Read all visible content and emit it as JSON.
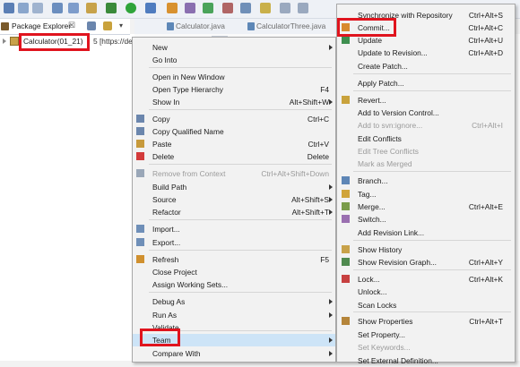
{
  "package_explorer": {
    "tab_label": "Package Explorer",
    "tab_close": "☒",
    "project_label": "Calculator(01_21)",
    "project_suffix": "5 [https://de"
  },
  "editor": {
    "tabs": [
      "Calculator.java",
      "CalculatorThree.java"
    ]
  },
  "context_menu": {
    "items": [
      {
        "label": "New",
        "shortcut": "",
        "submenu": true,
        "enabled": true
      },
      {
        "label": "Go Into",
        "shortcut": "",
        "submenu": false,
        "enabled": true
      },
      {
        "label": "Open in New Window",
        "shortcut": "",
        "submenu": false,
        "enabled": true
      },
      {
        "label": "Open Type Hierarchy",
        "shortcut": "F4",
        "submenu": false,
        "enabled": true
      },
      {
        "label": "Show In",
        "shortcut": "Alt+Shift+W",
        "submenu": true,
        "enabled": true
      },
      {
        "label": "Copy",
        "shortcut": "Ctrl+C",
        "submenu": false,
        "enabled": true
      },
      {
        "label": "Copy Qualified Name",
        "shortcut": "",
        "submenu": false,
        "enabled": true
      },
      {
        "label": "Paste",
        "shortcut": "Ctrl+V",
        "submenu": false,
        "enabled": true
      },
      {
        "label": "Delete",
        "shortcut": "Delete",
        "submenu": false,
        "enabled": true
      },
      {
        "label": "Remove from Context",
        "shortcut": "Ctrl+Alt+Shift+Down",
        "submenu": false,
        "enabled": false
      },
      {
        "label": "Build Path",
        "shortcut": "",
        "submenu": true,
        "enabled": true
      },
      {
        "label": "Source",
        "shortcut": "Alt+Shift+S",
        "submenu": true,
        "enabled": true
      },
      {
        "label": "Refactor",
        "shortcut": "Alt+Shift+T",
        "submenu": true,
        "enabled": true
      },
      {
        "label": "Import...",
        "shortcut": "",
        "submenu": false,
        "enabled": true
      },
      {
        "label": "Export...",
        "shortcut": "",
        "submenu": false,
        "enabled": true
      },
      {
        "label": "Refresh",
        "shortcut": "F5",
        "submenu": false,
        "enabled": true
      },
      {
        "label": "Close Project",
        "shortcut": "",
        "submenu": false,
        "enabled": true
      },
      {
        "label": "Assign Working Sets...",
        "shortcut": "",
        "submenu": false,
        "enabled": true
      },
      {
        "label": "Debug As",
        "shortcut": "",
        "submenu": true,
        "enabled": true
      },
      {
        "label": "Run As",
        "shortcut": "",
        "submenu": true,
        "enabled": true
      },
      {
        "label": "Validate",
        "shortcut": "",
        "submenu": false,
        "enabled": true
      },
      {
        "label": "Team",
        "shortcut": "",
        "submenu": true,
        "enabled": true
      },
      {
        "label": "Compare With",
        "shortcut": "",
        "submenu": true,
        "enabled": true
      }
    ]
  },
  "team_menu": {
    "items": [
      {
        "label": "Synchronize with Repository",
        "shortcut": "Ctrl+Alt+S",
        "enabled": true
      },
      {
        "label": "Commit...",
        "shortcut": "Ctrl+Alt+C",
        "enabled": true
      },
      {
        "label": "Update",
        "shortcut": "Ctrl+Alt+U",
        "enabled": true
      },
      {
        "label": "Update to Revision...",
        "shortcut": "Ctrl+Alt+D",
        "enabled": true
      },
      {
        "label": "Create Patch...",
        "shortcut": "",
        "enabled": true
      },
      {
        "label": "Apply Patch...",
        "shortcut": "",
        "enabled": true
      },
      {
        "label": "Revert...",
        "shortcut": "",
        "enabled": true
      },
      {
        "label": "Add to Version Control...",
        "shortcut": "",
        "enabled": true
      },
      {
        "label": "Add to svn:ignore...",
        "shortcut": "Ctrl+Alt+I",
        "enabled": false
      },
      {
        "label": "Edit Conflicts",
        "shortcut": "",
        "enabled": true
      },
      {
        "label": "Edit Tree Conflicts",
        "shortcut": "",
        "enabled": false
      },
      {
        "label": "Mark as Merged",
        "shortcut": "",
        "enabled": false
      },
      {
        "label": "Branch...",
        "shortcut": "",
        "enabled": true
      },
      {
        "label": "Tag...",
        "shortcut": "",
        "enabled": true
      },
      {
        "label": "Merge...",
        "shortcut": "Ctrl+Alt+E",
        "enabled": true
      },
      {
        "label": "Switch...",
        "shortcut": "",
        "enabled": true
      },
      {
        "label": "Add Revision Link...",
        "shortcut": "",
        "enabled": true
      },
      {
        "label": "Show History",
        "shortcut": "",
        "enabled": true
      },
      {
        "label": "Show Revision Graph...",
        "shortcut": "Ctrl+Alt+Y",
        "enabled": true
      },
      {
        "label": "Lock...",
        "shortcut": "Ctrl+Alt+K",
        "enabled": true
      },
      {
        "label": "Unlock...",
        "shortcut": "",
        "enabled": true
      },
      {
        "label": "Scan Locks",
        "shortcut": "",
        "enabled": true
      },
      {
        "label": "Show Properties",
        "shortcut": "Ctrl+Alt+T",
        "enabled": true
      },
      {
        "label": "Set Property...",
        "shortcut": "",
        "enabled": true
      },
      {
        "label": "Set Keywords...",
        "shortcut": "",
        "enabled": false
      },
      {
        "label": "Set External Definition...",
        "shortcut": "",
        "enabled": true
      }
    ]
  },
  "highlight_color": "#e0141e"
}
